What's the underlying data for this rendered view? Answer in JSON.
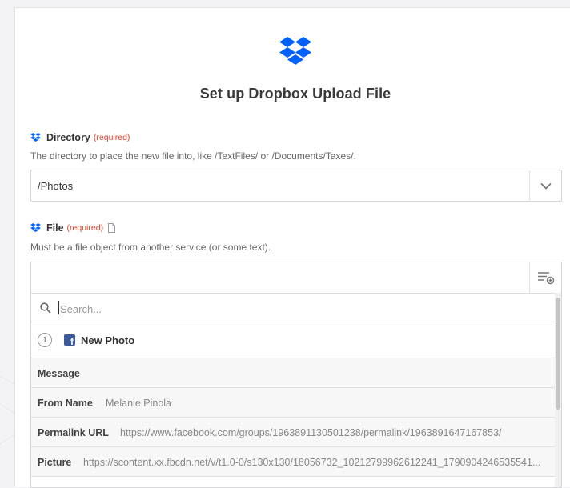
{
  "header": {
    "title": "Set up Dropbox Upload File",
    "logo_icon": "dropbox-logo-icon",
    "accent_color": "#0061fe"
  },
  "directory_field": {
    "label": "Directory",
    "required_text": "(required)",
    "help": "The directory to place the new file into, like /TextFiles/ or /Documents/Taxes/.",
    "value": "/Photos",
    "dropdown_icon": "chevron-down-icon"
  },
  "file_field": {
    "label": "File",
    "required_text": "(required)",
    "help": "Must be a file object from another service (or some text).",
    "value": "",
    "insert_icon": "insert-data-icon"
  },
  "picker": {
    "search_placeholder": "Search...",
    "step": {
      "number": "1",
      "app_icon": "facebook-icon",
      "label": "New Photo"
    },
    "rows": [
      {
        "key": "Message",
        "value": ""
      },
      {
        "key": "From Name",
        "value": "Melanie Pinola"
      },
      {
        "key": "Permalink URL",
        "value": "https://www.facebook.com/groups/1963891130501238/permalink/1963891647167853/"
      },
      {
        "key": "Picture",
        "value": "https://scontent.xx.fbcdn.net/v/t1.0-0/s130x130/18056732_10212799962612241_1790904246535541..."
      }
    ]
  },
  "colors": {
    "required": "#d9472b",
    "facebook": "#3b5998"
  }
}
